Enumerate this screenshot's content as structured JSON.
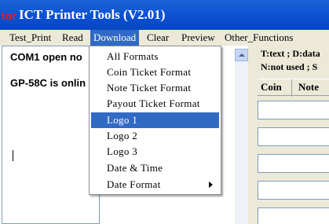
{
  "app": {
    "icon_text": "tor",
    "title": "ICT Printer Tools (V2.01)"
  },
  "menubar": {
    "items": [
      {
        "label": "Test_Print"
      },
      {
        "label": "Read"
      },
      {
        "label": "Download"
      },
      {
        "label": "Clear"
      },
      {
        "label": "Preview"
      },
      {
        "label": "Other_Functions"
      }
    ],
    "active": "Download"
  },
  "status": {
    "lines": [
      "COM1  open no",
      "GP-58C is onlin"
    ]
  },
  "right_panel": {
    "legend_lines": [
      "T:text ; D:data",
      "N:not used ; S"
    ],
    "columns": [
      "Coin",
      "Note"
    ]
  },
  "dropdown": {
    "items": [
      {
        "label": "All Formats"
      },
      {
        "label": "Coin  Ticket  Format"
      },
      {
        "label": "Note  Ticket  Format"
      },
      {
        "label": "Payout  Ticket  Format"
      },
      {
        "label": "Logo  1"
      },
      {
        "label": "Logo  2"
      },
      {
        "label": "Logo  3"
      },
      {
        "label": "Date  &  Time"
      },
      {
        "label": "Date  Format"
      }
    ],
    "selected": "Logo  1",
    "submenu_item": "Date  Format"
  }
}
